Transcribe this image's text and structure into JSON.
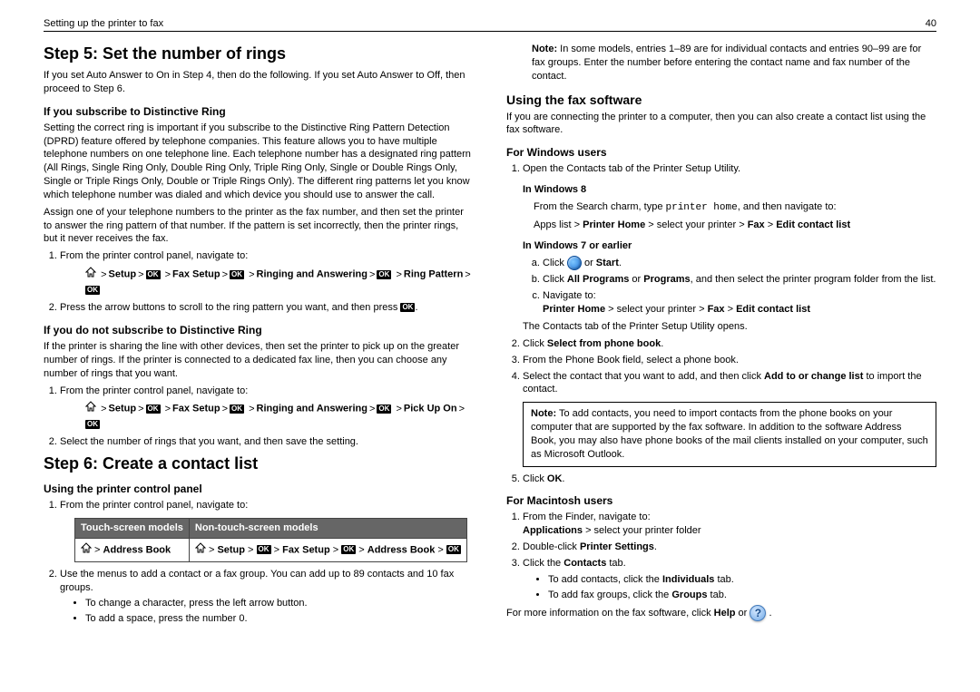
{
  "header": {
    "left": "Setting up the printer to fax",
    "right": "40"
  },
  "ok_label": "OK",
  "col1": {
    "h1a": "Step 5: Set the number of rings",
    "p1": "If you set Auto Answer to On in Step 4, then do the following. If you set Auto Answer to Off, then proceed to Step 6.",
    "h3a": "If you subscribe to Distinctive Ring",
    "p2": "Setting the correct ring is important if you subscribe to the Distinctive Ring Pattern Detection (DPRD) feature offered by telephone companies. This feature allows you to have multiple telephone numbers on one telephone line. Each telephone number has a designated ring pattern (All Rings, Single Ring Only, Double Ring Only, Triple Ring Only, Single or Double Rings Only, Single or Triple Rings Only, Double or Triple Rings Only). The different ring patterns let you know which telephone number was dialed and which device you should use to answer the call.",
    "p3": "Assign one of your telephone numbers to the printer as the fax number, and then set the printer to answer the ring pattern of that number. If the pattern is set incorrectly, then the printer rings, but it never receives the fax.",
    "ol1_1": "From the printer control panel, navigate to:",
    "nav1": {
      "setup": "Setup",
      "fax": "Fax Setup",
      "ring_ans": "Ringing and Answering",
      "ring_pat": "Ring Pattern"
    },
    "ol1_2_pre": "Press the arrow buttons to scroll to the ring pattern you want, and then press ",
    "ol1_2_post": ".",
    "h3b": "If you do not subscribe to Distinctive Ring",
    "p4": "If the printer is sharing the line with other devices, then set the printer to pick up on the greater number of rings. If the printer is connected to a dedicated fax line, then you can choose any number of rings that you want.",
    "ol2_1": "From the printer control panel, navigate to:",
    "nav2": {
      "setup": "Setup",
      "fax": "Fax Setup",
      "ring_ans": "Ringing and Answering",
      "pickup": "Pick Up On"
    },
    "ol2_2": "Select the number of rings that you want, and then save the setting.",
    "h1b": "Step 6: Create a contact list",
    "h3c": "Using the printer control panel",
    "ol3_1": "From the printer control panel, navigate to:",
    "table": {
      "th1": "Touch‑screen models",
      "th2": "Non‑touch‑screen models",
      "td1_label": "Address Book",
      "td2": {
        "setup": "Setup",
        "fax": "Fax Setup",
        "addr": "Address Book"
      }
    },
    "ol3_2": "Use the menus to add a contact or a fax group. You can add up to 89 contacts and 10 fax groups.",
    "ul3a": "To change a character, press the left arrow button.",
    "ul3b": "To add a space, press the number 0."
  },
  "col2": {
    "notetop_pre": "Note:",
    "notetop": " In some models, entries 1–89 are for individual contacts and entries 90–99 are for fax groups. Enter the number before entering the contact name and fax number of the contact.",
    "h2a": "Using the fax software",
    "p1": "If you are connecting the printer to a computer, then you can also create a contact list using the fax software.",
    "h3a": "For Windows users",
    "ol1_1": "Open the Contacts tab of the Printer Setup Utility.",
    "h4a": "In Windows 8",
    "p2_pre": "From the Search charm, type ",
    "p2_code": "printer home",
    "p2_post": ", and then navigate to:",
    "nav_w8_pre": "Apps list > ",
    "nav_w8_b1": "Printer Home",
    "nav_w8_mid": " > select your printer > ",
    "nav_w8_b2": "Fax",
    "nav_w8_b3": "Edit contact list",
    "h4b": "In Windows 7 or earlier",
    "alpha_a_pre": "Click ",
    "alpha_a_post": " or ",
    "alpha_a_b": "Start",
    "alpha_b_pre": "Click ",
    "alpha_b_b1": "All Programs",
    "alpha_b_mid": " or ",
    "alpha_b_b2": "Programs",
    "alpha_b_post": ", and then select the printer program folder from the list.",
    "alpha_c": "Navigate to:",
    "nav_w7_b1": "Printer Home",
    "nav_w7_mid": " > select your printer > ",
    "nav_w7_b2": "Fax",
    "nav_w7_b3": "Edit contact list",
    "p3": "The Contacts tab of the Printer Setup Utility opens.",
    "ol1_2_pre": "Click ",
    "ol1_2_b": "Select from phone book",
    "ol1_3": "From the Phone Book field, select a phone book.",
    "ol1_4_pre": "Select the contact that you want to add, and then click ",
    "ol1_4_b": "Add to or change list",
    "ol1_4_post": " to import the contact.",
    "notebox_pre": "Note:",
    "notebox": " To add contacts, you need to import contacts from the phone books on your computer that are supported by the fax software. In addition to the software Address Book, you may also have phone books of the mail clients installed on your computer, such as Microsoft Outlook.",
    "ol1_5_pre": "Click ",
    "ol1_5_b": "OK",
    "h3b": "For Macintosh users",
    "mac_ol1": "From the Finder, navigate to:",
    "mac_nav_b": "Applications",
    "mac_nav_post": " > select your printer folder",
    "mac_ol2_pre": "Double‑click ",
    "mac_ol2_b": "Printer Settings",
    "mac_ol3_pre": "Click the ",
    "mac_ol3_b": "Contacts",
    "mac_ol3_post": " tab.",
    "mac_ul_a_pre": "To add contacts, click the ",
    "mac_ul_a_b": "Individuals",
    "mac_ul_a_post": " tab.",
    "mac_ul_b_pre": "To add fax groups, click the ",
    "mac_ul_b_b": "Groups",
    "mac_ul_b_post": " tab.",
    "footer_pre": "For more information on the fax software, click ",
    "footer_b": "Help",
    "footer_mid": " or "
  }
}
